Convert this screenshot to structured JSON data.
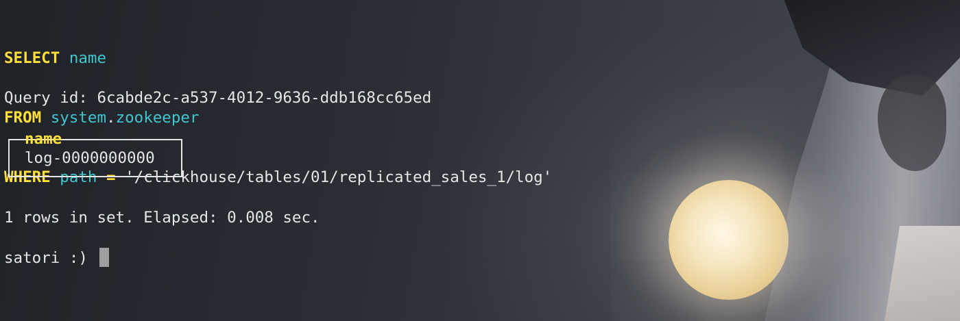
{
  "query": {
    "select_kw": "SELECT",
    "select_col": "name",
    "from_kw": "FROM",
    "from_db": "system",
    "from_dot": ".",
    "from_table": "zookeeper",
    "where_kw": "WHERE",
    "where_col": "path",
    "where_op": "=",
    "where_value": "'/clickhouse/tables/01/replicated_sales_1/log'"
  },
  "query_id_line": "Query id: 6cabde2c-a537-4012-9636-ddb168cc65ed",
  "result": {
    "column_header": "name",
    "rows": [
      "log-0000000000"
    ]
  },
  "summary_line": "1 rows in set. Elapsed: 0.008 sec.",
  "prompt": "satori :) ",
  "colors": {
    "keyword": "#ffe03a",
    "identifier": "#3fc6cf",
    "text": "#e6e6e6",
    "cursor": "#a0a0a0"
  }
}
